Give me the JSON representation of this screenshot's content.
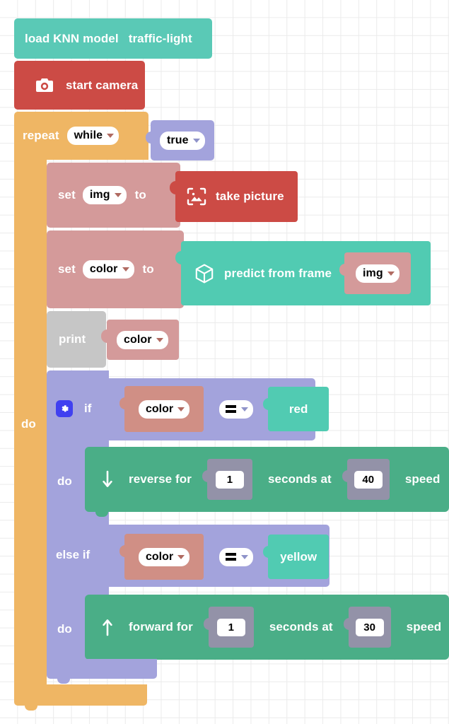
{
  "workspace": {
    "name": "blockly-workspace",
    "background": "#ffffff",
    "grid_color": "#ebebeb"
  },
  "colors": {
    "ml_teal": "#5ac9b6",
    "camera_red": "#cc4b45",
    "loop_orange": "#efb664",
    "logic_purple": "#a3a3dc",
    "variable_pink": "#d49a9a",
    "variable_pink_dark": "#d08f85",
    "text_gray": "#c6c6c6",
    "motion_green": "#4aae87",
    "number_gray": "#9392a8",
    "value_teal": "#51cbb2",
    "gear_blue": "#4040f0"
  },
  "blocks": {
    "load_model": {
      "label": "load KNN model",
      "model_name": "traffic-light"
    },
    "start_camera": {
      "label": "start camera",
      "icon": "camera-icon"
    },
    "repeat": {
      "keyword": "repeat",
      "mode": "while",
      "condition": "true",
      "do_label": "do"
    },
    "set_img": {
      "keyword": "set",
      "variable": "img",
      "to_label": "to",
      "value_label": "take picture",
      "value_icon": "image-frame-icon"
    },
    "set_color": {
      "keyword": "set",
      "variable": "color",
      "to_label": "to",
      "value_label": "predict from frame",
      "value_icon": "cube-icon",
      "value_arg": "img"
    },
    "print": {
      "keyword": "print",
      "argument": "color"
    },
    "if_block": {
      "gear_icon": "gear-icon",
      "if_label": "if",
      "left_operand": "color",
      "operator": "=",
      "right_operand": "red",
      "do_label": "do",
      "elseif_label": "else if",
      "elseif_left_operand": "color",
      "elseif_operator": "=",
      "elseif_right_operand": "yellow",
      "elseif_do_label": "do"
    },
    "reverse": {
      "direction_icon": "arrow-down-icon",
      "action_label": "reverse for",
      "duration": "1",
      "mid_label": "seconds at",
      "speed": "40",
      "speed_label": "speed"
    },
    "forward": {
      "direction_icon": "arrow-up-icon",
      "action_label": "forward for",
      "duration": "1",
      "mid_label": "seconds at",
      "speed": "30",
      "speed_label": "speed"
    }
  }
}
